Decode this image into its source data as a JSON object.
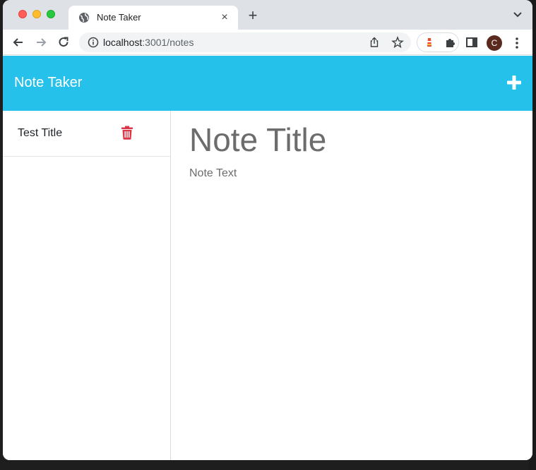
{
  "browser": {
    "tab_title": "Note Taker",
    "url_host": "localhost",
    "url_path": ":3001/notes",
    "profile_initial": "C",
    "new_tab_label": "+",
    "close_tab_label": "×"
  },
  "app": {
    "brand": "Note Taker",
    "accent_color": "#26c1ea",
    "delete_color": "#dc3545",
    "notes": [
      {
        "title": "Test Title"
      }
    ],
    "editor": {
      "title_placeholder": "Note Title",
      "text_placeholder": "Note Text"
    }
  },
  "icons": {
    "tab_favicon": "globe-icon",
    "back": "arrow-left-icon",
    "forward": "arrow-right-icon",
    "reload": "reload-icon",
    "site_info": "info-icon",
    "share": "share-icon",
    "bookmark": "star-icon",
    "extension1": "lighthouse-icon",
    "extension2": "puzzle-icon",
    "side_panel": "side-panel-icon",
    "menu": "kebab-menu-icon",
    "tab_search": "chevron-down-icon",
    "add_note": "plus-icon",
    "delete_note": "trash-icon"
  }
}
